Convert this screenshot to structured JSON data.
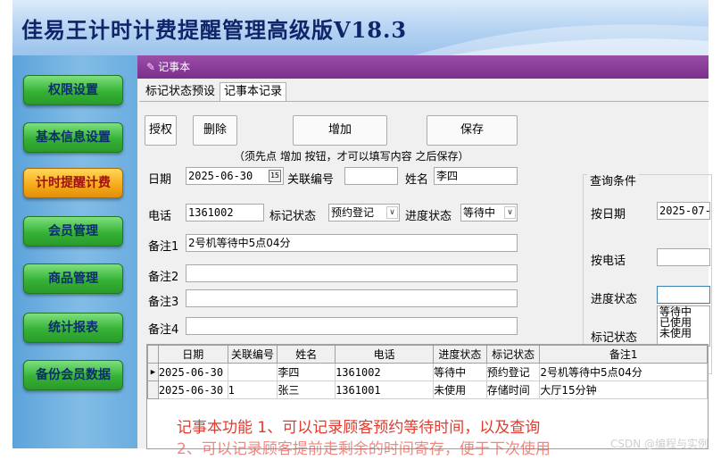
{
  "header": {
    "title": "佳易王计时计费提醒管理高级版V18.3"
  },
  "sidebar": {
    "items": [
      {
        "label": "权限设置",
        "active": false
      },
      {
        "label": "基本信息设置",
        "active": false
      },
      {
        "label": "计时提醒计费",
        "active": true
      },
      {
        "label": "会员管理",
        "active": false
      },
      {
        "label": "商品管理",
        "active": false
      },
      {
        "label": "统计报表",
        "active": false
      },
      {
        "label": "备份会员数据",
        "active": false
      }
    ]
  },
  "window": {
    "title": "记事本"
  },
  "tabs": [
    {
      "label": "标记状态预设"
    },
    {
      "label": "记事本记录",
      "active": true
    }
  ],
  "toolbar": {
    "authorize": "授权",
    "delete": "删除",
    "add": "增加",
    "save": "保存",
    "hint": "（须先点 增加 按钮，才可以填写内容 之后保存）"
  },
  "form": {
    "date_label": "日期",
    "date_value": "2025-06-30",
    "calendar_glyph": "15",
    "ref_label": "关联编号",
    "ref_value": "",
    "name_label": "姓名",
    "name_value": "李四",
    "phone_label": "电话",
    "phone_value": "1361002",
    "mark_label": "标记状态",
    "mark_value": "预约登记",
    "progress_label": "进度状态",
    "progress_value": "等待中",
    "note1_label": "备注1",
    "note1_value": "2号机等待中5点04分",
    "note2_label": "备注2",
    "note3_label": "备注3",
    "note4_label": "备注4"
  },
  "query": {
    "title": "查询条件",
    "by_date_label": "按日期",
    "by_date_value": "2025-07-",
    "by_phone_label": "按电话",
    "progress_label": "进度状态",
    "mark_label": "标记状态",
    "mark_options": [
      "等待中",
      "已使用",
      "未使用"
    ]
  },
  "table": {
    "columns": [
      "日期",
      "关联编号",
      "姓名",
      "电话",
      "进度状态",
      "标记状态",
      "备注1"
    ],
    "rows": [
      {
        "date": "2025-06-30",
        "ref": "",
        "name": "李四",
        "phone": "1361002",
        "progress": "等待中",
        "mark": "预约登记",
        "note1": "2号机等待中5点04分"
      },
      {
        "date": "2025-06-30",
        "ref": "1",
        "name": "张三",
        "phone": "1361001",
        "progress": "未使用",
        "mark": "存储时间",
        "note1": "大厅15分钟"
      }
    ]
  },
  "notes": {
    "line1": "记事本功能 1、可以记录顾客预约等待时间，以及查询",
    "line2": "2、可以记录顾客提前走剩余的时间寄存，便于下次使用"
  },
  "watermark": "CSDN @编程与实例",
  "colors": {
    "accent": "#7a2f8c",
    "nav_green": "#36b236",
    "nav_active": "#f6a817",
    "note_red": "#e23b2e"
  }
}
